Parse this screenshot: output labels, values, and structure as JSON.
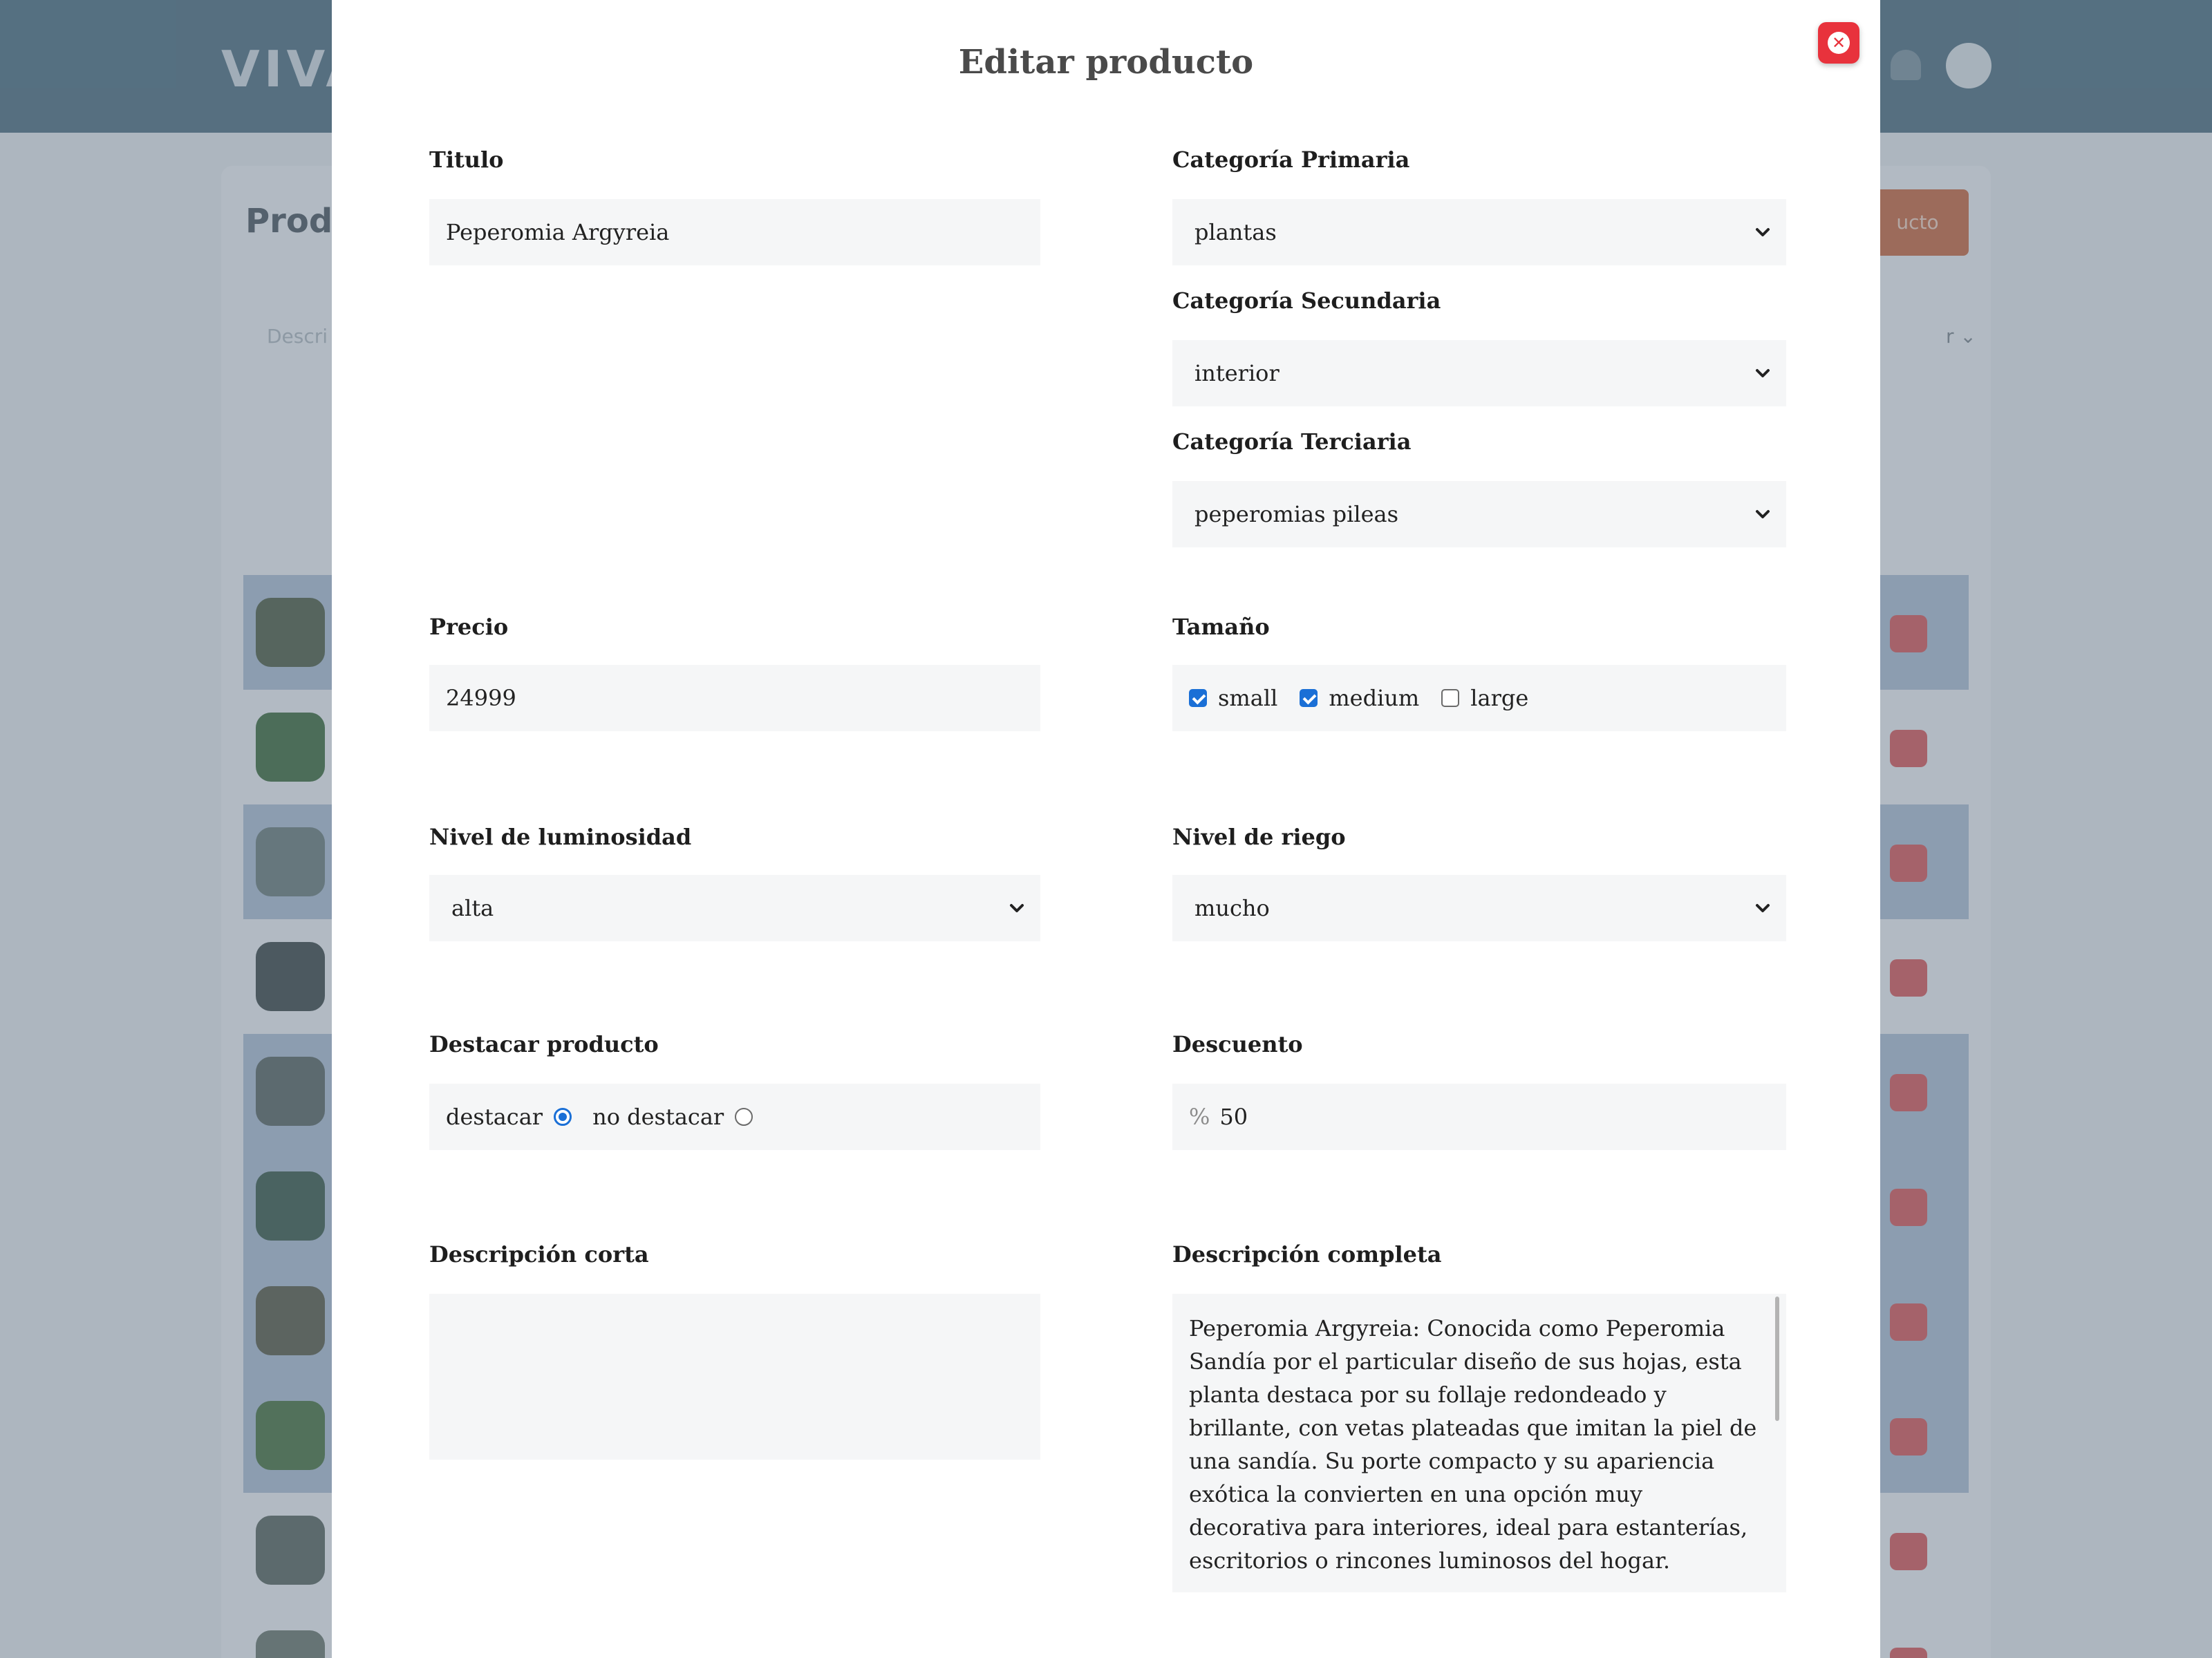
{
  "background": {
    "logo": "VIVA",
    "page_title": "Prod",
    "add_button": "ucto",
    "search_placeholder": "Descri",
    "filter_text": "r",
    "row_thumb_colors": [
      "#5f6d54",
      "#4f7a4c",
      "#7a8a86",
      "#4f5a58",
      "#6a7570",
      "#4d6a5a",
      "#6a6b58",
      "#5a8050",
      "#6a756c",
      "#7a857a"
    ]
  },
  "modal": {
    "title": "Editar producto",
    "close_icon": "close-icon",
    "fields": {
      "titulo": {
        "label": "Titulo",
        "value": "Peperomia Argyreia"
      },
      "categoria_primaria": {
        "label": "Categoría Primaria",
        "value": "plantas"
      },
      "categoria_secundaria": {
        "label": "Categoría Secundaria",
        "value": "interior"
      },
      "categoria_terciaria": {
        "label": "Categoría Terciaria",
        "value": "peperomias pileas"
      },
      "precio": {
        "label": "Precio",
        "value": "24999"
      },
      "tamano": {
        "label": "Tamaño",
        "options": [
          {
            "label": "small",
            "checked": true
          },
          {
            "label": "medium",
            "checked": true
          },
          {
            "label": "large",
            "checked": false
          }
        ]
      },
      "luminosidad": {
        "label": "Nivel de luminosidad",
        "value": "alta"
      },
      "riego": {
        "label": "Nivel de riego",
        "value": "mucho"
      },
      "destacar": {
        "label": "Destacar producto",
        "options": [
          {
            "label": "destacar",
            "selected": true
          },
          {
            "label": "no destacar",
            "selected": false
          }
        ]
      },
      "descuento": {
        "label": "Descuento",
        "prefix": "%",
        "value": "50"
      },
      "descripcion_corta": {
        "label": "Descripción corta",
        "value": ""
      },
      "descripcion_completa": {
        "label": "Descripción completa",
        "value": "Peperomia Argyreia: Conocida como Peperomia Sandía por el particular diseño de sus hojas, esta planta destaca por su follaje redondeado y brillante, con vetas plateadas que imitan la piel de una sandía. Su porte compacto y su apariencia exótica la convierten en una opción muy decorativa para interiores, ideal para estanterías, escritorios o rincones luminosos del hogar.\n\nSe desarrolla mejor en ambientes con luz natural"
      }
    }
  },
  "colors": {
    "accent": "#1a6fd6",
    "close": "#e8323c",
    "header": "#5f7d8c",
    "field_bg": "#f5f6f7"
  }
}
